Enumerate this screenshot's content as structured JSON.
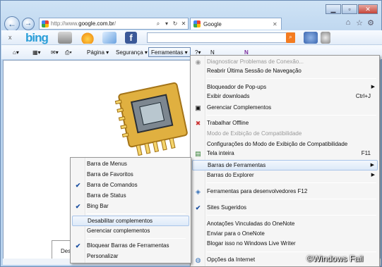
{
  "address": {
    "prefix": "http://www.",
    "domain": "google.com.br",
    "suffix": "/"
  },
  "tab": {
    "title": "Google"
  },
  "cmdbar": {
    "page": "Página ▾",
    "security": "Segurança ▾",
    "tools": "Ferramentas ▾"
  },
  "content": {
    "dialog_text": "Des"
  },
  "tools_menu": [
    {
      "label": "Diagnosticar Problemas de Conexão...",
      "disabled": true
    },
    {
      "label": "Reabrir Última Sessão de Navegação"
    },
    {
      "label": "Bloqueador de Pop-ups",
      "submenu": true
    },
    {
      "label": "Exibir downloads",
      "shortcut": "Ctrl+J"
    },
    {
      "label": "Gerenciar Complementos"
    },
    {
      "label": "Trabalhar Offline"
    },
    {
      "label": "Modo de Exibição de Compatibilidade",
      "disabled": true
    },
    {
      "label": "Configurações do Modo de Exibição de Compatibilidade"
    },
    {
      "label": "Tela inteira",
      "shortcut": "F11"
    },
    {
      "label": "Barras de Ferramentas",
      "submenu": true,
      "highlighted": true
    },
    {
      "label": "Barras do Explorer",
      "submenu": true
    },
    {
      "label": "Ferramentas para desenvolvedores F12"
    },
    {
      "label": "Sites Sugeridos",
      "checked": true
    },
    {
      "label": "Anotações Vinculadas do OneNote"
    },
    {
      "label": "Enviar para o OneNote"
    },
    {
      "label": "Blogar isso no Windows Live Writer"
    },
    {
      "label": "Opções da Internet"
    }
  ],
  "toolbars_submenu": [
    {
      "label": "Barra de Menus"
    },
    {
      "label": "Barra de Favoritos"
    },
    {
      "label": "Barra de Comandos",
      "checked": true
    },
    {
      "label": "Barra de Status"
    },
    {
      "label": "Bing Bar",
      "checked": true
    },
    {
      "label": "Desabilitar complementos",
      "highlighted": true
    },
    {
      "label": "Gerenciar complementos"
    },
    {
      "label": "Bloquear Barras de Ferramentas",
      "checked": true
    },
    {
      "label": "Personalizar"
    }
  ],
  "watermark": "©Windows Fail",
  "colors": {
    "accent": "#2a9ed8",
    "highlight": "#dde9f8",
    "frame": "#b9d3ee"
  }
}
